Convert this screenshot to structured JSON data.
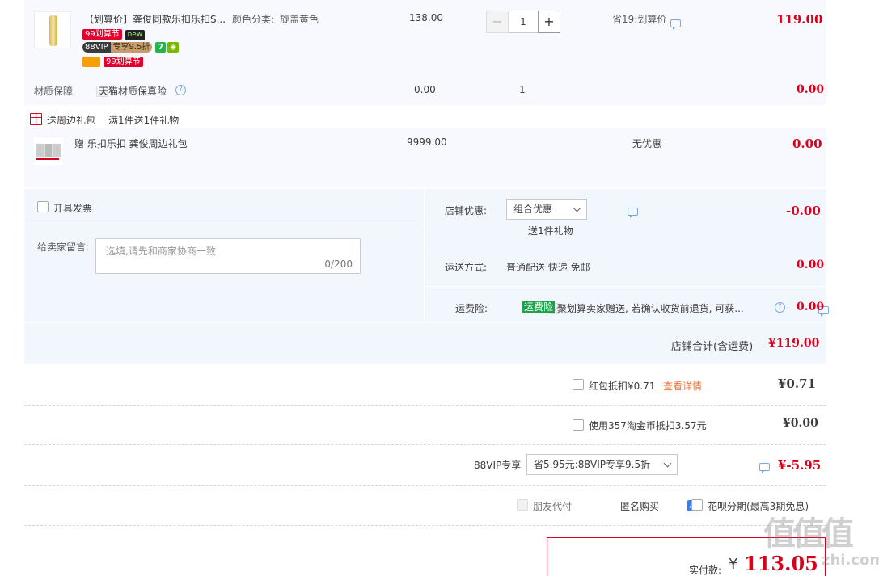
{
  "item": {
    "title": "【划算价】龚俊同款乐扣乐扣S...",
    "sku_label": "颜色分类:",
    "sku_value": "旋盖黄色",
    "price": "138.00",
    "qty": "1",
    "promo": "省19:划算价",
    "total": "119.00",
    "badge_99": "99划算节",
    "badge_new": "new",
    "badge_88": "88VIP",
    "badge_88_discount": "专享9.5折",
    "badge_7": "7",
    "badge_99b": "99划算节"
  },
  "insurance": {
    "label": "材质保障",
    "name": "天猫材质保真险",
    "price": "0.00",
    "qty": "1",
    "total": "0.00"
  },
  "gift_header": {
    "label": "送周边礼包",
    "rule": "满1件送1件礼物"
  },
  "gift": {
    "name": "赠 乐扣乐扣 龚俊周边礼包",
    "price": "9999.00",
    "promo": "无优惠",
    "total": "0.00"
  },
  "invoice": {
    "label": "开具发票"
  },
  "message": {
    "label": "给卖家留言:",
    "placeholder": "选填,请先和商家协商一致",
    "counter": "0/200"
  },
  "shop_discount": {
    "label": "店铺优惠:",
    "select": "组合优惠",
    "sub": "送1件礼物",
    "value": "-0.00"
  },
  "shipping": {
    "label": "运送方式:",
    "value": "普通配送 快递 免邮",
    "price": "0.00"
  },
  "freight_ins": {
    "label": "运费险:",
    "tag": "运费险",
    "desc": "聚划算卖家赠送, 若确认收货前退货, 可获...",
    "price": "0.00"
  },
  "shop_total": {
    "label": "店铺合计(含运费)",
    "value": "¥119.00"
  },
  "redpacket": {
    "label": "红包抵扣¥0.71",
    "link": "查看详情",
    "value": "¥0.71"
  },
  "taojin": {
    "label": "使用357淘金币抵扣3.57元",
    "value": "¥0.00"
  },
  "vip88": {
    "label": "88VIP专享",
    "select": "省5.95元:88VIP专享9.5折",
    "value": "¥-5.95"
  },
  "options": {
    "friend_pay": "朋友代付",
    "anonymous": "匿名购买",
    "huabei": "花呗分期(最高3期免息)"
  },
  "pay": {
    "label": "实付款:",
    "currency": "¥",
    "amount": "113.05"
  },
  "watermark": {
    "site": "值值值",
    "url": "zhi.com"
  }
}
